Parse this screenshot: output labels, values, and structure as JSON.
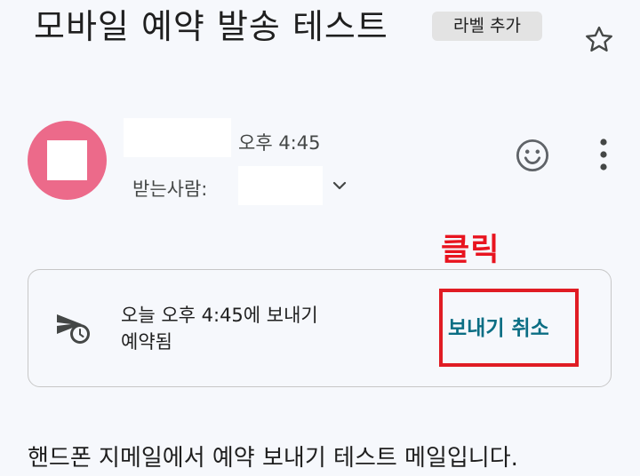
{
  "header": {
    "subject": "모바일 예약 발송 테스트",
    "add_label": "라벨 추가",
    "star_icon": "star-outline-icon"
  },
  "message": {
    "time": "오후 4:45",
    "recipient_label": "받는사람:",
    "avatar_color": "#ec6a8a",
    "icons": [
      "add-emoji-icon",
      "more-vert-icon",
      "chevron-down-icon"
    ]
  },
  "annotation": {
    "text": "클릭",
    "color": "#e8141f"
  },
  "scheduled_card": {
    "line1": "오늘 오후 4:45에 보내기",
    "line2": "예약됨",
    "cancel_label": "보내기 취소",
    "icon": "scheduled-send-icon",
    "accent_color": "#0b6e84"
  },
  "body": {
    "text": "핸드폰 지메일에서 예약 보내기 테스트 메일입니다."
  }
}
